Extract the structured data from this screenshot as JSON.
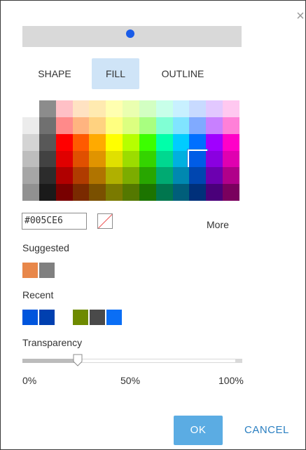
{
  "close": {
    "glyph": "×"
  },
  "preview": {
    "color": "#1a5ce8"
  },
  "tabs": [
    {
      "label": "SHAPE",
      "active": false
    },
    {
      "label": "FILL",
      "active": true
    },
    {
      "label": "OUTLINE",
      "active": false
    }
  ],
  "palette": {
    "rows": [
      [
        "#ffffff",
        "#8c8c8c",
        "#ffc0c6",
        "#ffe2c2",
        "#ffeab0",
        "#ffffb0",
        "#eaffb0",
        "#d2ffc2",
        "#c8ffe9",
        "#c8f0ff",
        "#c8daff",
        "#e2c8ff",
        "#ffc8f0"
      ],
      [
        "#ececec",
        "#707070",
        "#ff8a8a",
        "#ffb480",
        "#ffd280",
        "#ffff80",
        "#dcff80",
        "#a8ff80",
        "#80ffd4",
        "#80e4ff",
        "#80aaff",
        "#c880ff",
        "#ff80d8"
      ],
      [
        "#d4d4d4",
        "#585858",
        "#ff0000",
        "#ff5a00",
        "#ffaa00",
        "#ffff00",
        "#b6ff00",
        "#3cff00",
        "#00ffaa",
        "#00ccff",
        "#0070ff",
        "#a000ff",
        "#ff00c8"
      ],
      [
        "#bdbdbd",
        "#424242",
        "#e00000",
        "#e05000",
        "#e09400",
        "#e0e000",
        "#9cdc00",
        "#34d400",
        "#00d890",
        "#00b0e0",
        "#005ce6",
        "#8a00e0",
        "#e000b0"
      ],
      [
        "#a6a6a6",
        "#2c2c2c",
        "#b00000",
        "#b03c00",
        "#b07400",
        "#b0b000",
        "#7cac00",
        "#28a600",
        "#00aa72",
        "#0088b0",
        "#0046b0",
        "#6c00b0",
        "#b0008a"
      ],
      [
        "#919191",
        "#1a1a1a",
        "#780000",
        "#7a2a00",
        "#7a5000",
        "#7a7a00",
        "#547800",
        "#1c7400",
        "#00764e",
        "#005e7a",
        "#00307a",
        "#4a007a",
        "#7a005e"
      ]
    ],
    "selected_value": "#005CE6"
  },
  "hex": {
    "value": "#005CE6"
  },
  "more_label": "More",
  "suggested": {
    "label": "Suggested",
    "swatches": [
      "#e8874a",
      "#808080"
    ]
  },
  "recent": {
    "label": "Recent",
    "swatches": [
      "#0055dd",
      "#0040b0",
      "#6e8a00",
      "#4a4a4a",
      "#0a6ef5"
    ]
  },
  "transparency": {
    "label": "Transparency",
    "value_percent": 25,
    "scale": [
      "0%",
      "50%",
      "100%"
    ]
  },
  "buttons": {
    "ok": "OK",
    "cancel": "CANCEL"
  }
}
